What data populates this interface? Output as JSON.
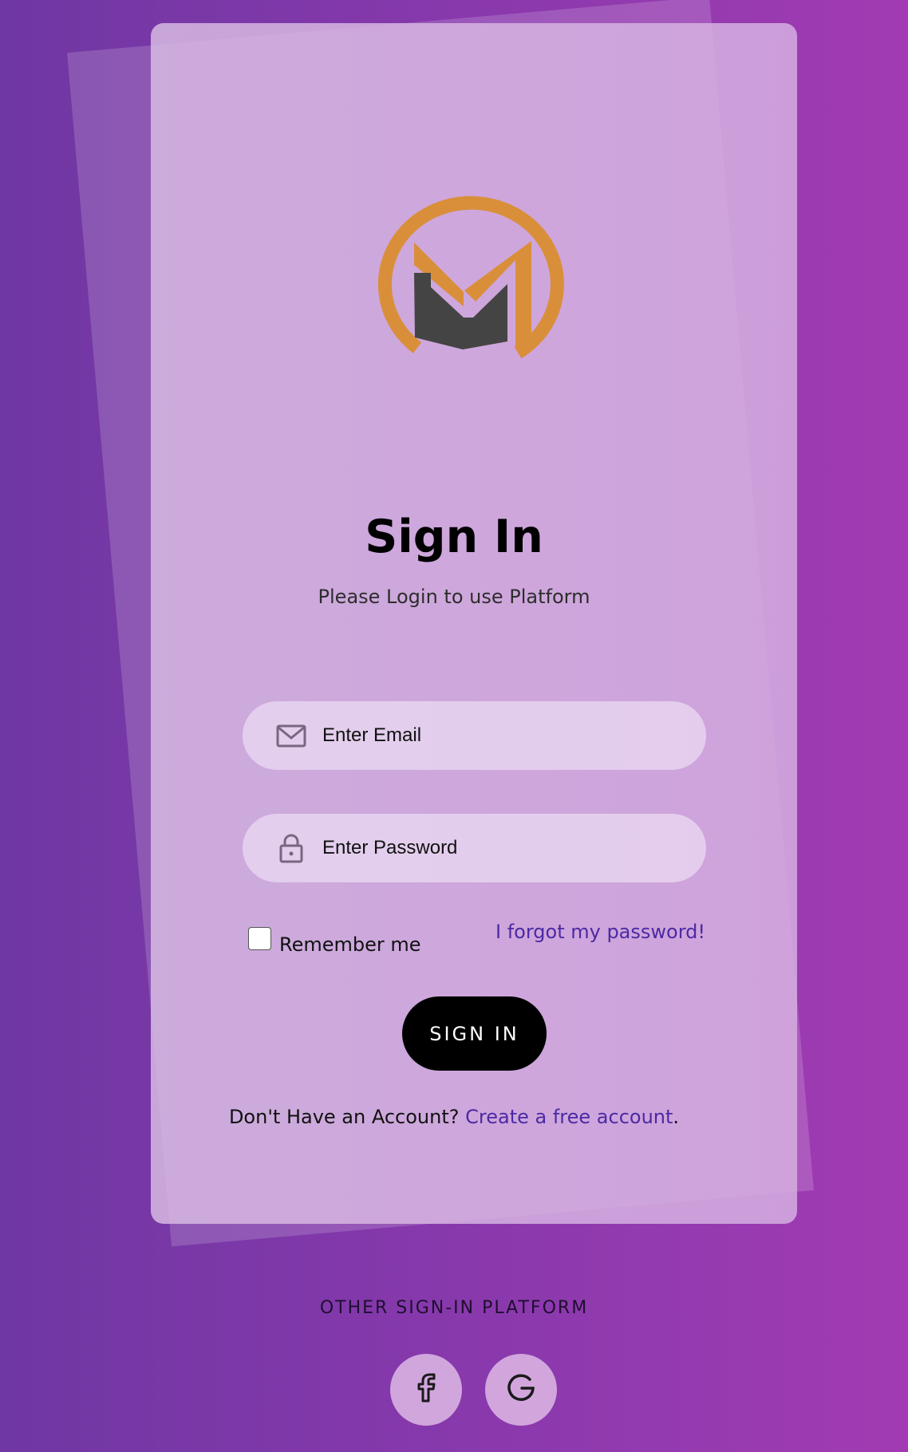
{
  "header": {
    "title": "Sign In",
    "subtitle": "Please Login to use Platform"
  },
  "form": {
    "email": {
      "placeholder": "Enter Email",
      "icon": "envelope-icon"
    },
    "password": {
      "placeholder": "Enter Password",
      "icon": "lock-icon"
    },
    "remember_label": "Remember me",
    "forgot_label": "I forgot my password!",
    "submit_label": "SIGN IN"
  },
  "account": {
    "prompt": "Don't Have an Account?",
    "link": "Create a free account",
    "suffix": "."
  },
  "other": {
    "label": "OTHER SIGN-IN PLATFORM",
    "platforms": [
      {
        "icon": "facebook-icon"
      },
      {
        "icon": "google-icon"
      }
    ]
  },
  "colors": {
    "bg_start": "#6f37a3",
    "bg_end": "#a23bb3",
    "logo_orange": "#d98f3a",
    "logo_dark": "#454444",
    "link": "#4b2aa3",
    "button": "#000000"
  }
}
